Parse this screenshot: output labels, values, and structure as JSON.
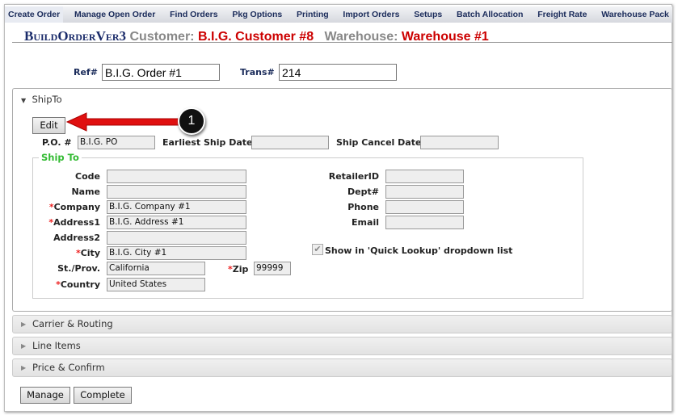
{
  "nav": {
    "tabs": [
      "Create Order",
      "Manage Open Order",
      "Find Orders",
      "Pkg Options",
      "Printing",
      "Import Orders",
      "Setups",
      "Batch Allocation",
      "Freight Rate",
      "Warehouse Pack"
    ],
    "active": 0
  },
  "header": {
    "app": "BuildOrderVer3",
    "customer_label": "Customer:",
    "customer": "B.I.G. Customer #8",
    "warehouse_label": "Warehouse:",
    "warehouse": "Warehouse #1"
  },
  "ref": {
    "label": "Ref#",
    "value": "B.I.G. Order #1"
  },
  "trans": {
    "label": "Trans#",
    "value": "214"
  },
  "shipto": {
    "section": "ShipTo",
    "edit": "Edit",
    "callout": "1",
    "po_label": "P.O. #",
    "po": "B.I.G. PO",
    "earliest_label": "Earliest Ship Date",
    "earliest": "",
    "cancel_label": "Ship Cancel Date",
    "cancel": "",
    "legend": "Ship To",
    "fields": [
      {
        "label": "Code",
        "value": "",
        "required": false
      },
      {
        "label": "Name",
        "value": "",
        "required": false
      },
      {
        "label": "Company",
        "value": "B.I.G. Company #1",
        "required": true
      },
      {
        "label": "Address1",
        "value": "B.I.G. Address #1",
        "required": true
      },
      {
        "label": "Address2",
        "value": "",
        "required": false
      },
      {
        "label": "City",
        "value": "B.I.G. City #1",
        "required": true
      },
      {
        "label": "St./Prov.",
        "value": "California",
        "required": false
      },
      {
        "label": "Country",
        "value": "United States",
        "required": true
      }
    ],
    "zip_label": "Zip",
    "zip": "99999",
    "right": [
      {
        "label": "RetailerID",
        "value": ""
      },
      {
        "label": "Dept#",
        "value": ""
      },
      {
        "label": "Phone",
        "value": ""
      },
      {
        "label": "Email",
        "value": ""
      }
    ],
    "quick_lookup": "Show in 'Quick Lookup' dropdown list",
    "quick_lookup_checked": true
  },
  "sections": [
    "Carrier & Routing",
    "Line Items",
    "Price & Confirm"
  ],
  "buttons": {
    "manage": "Manage",
    "complete": "Complete"
  },
  "colors": {
    "accent_red": "#cc0000",
    "legend_green": "#33bb33",
    "arrow": "#e01010"
  }
}
